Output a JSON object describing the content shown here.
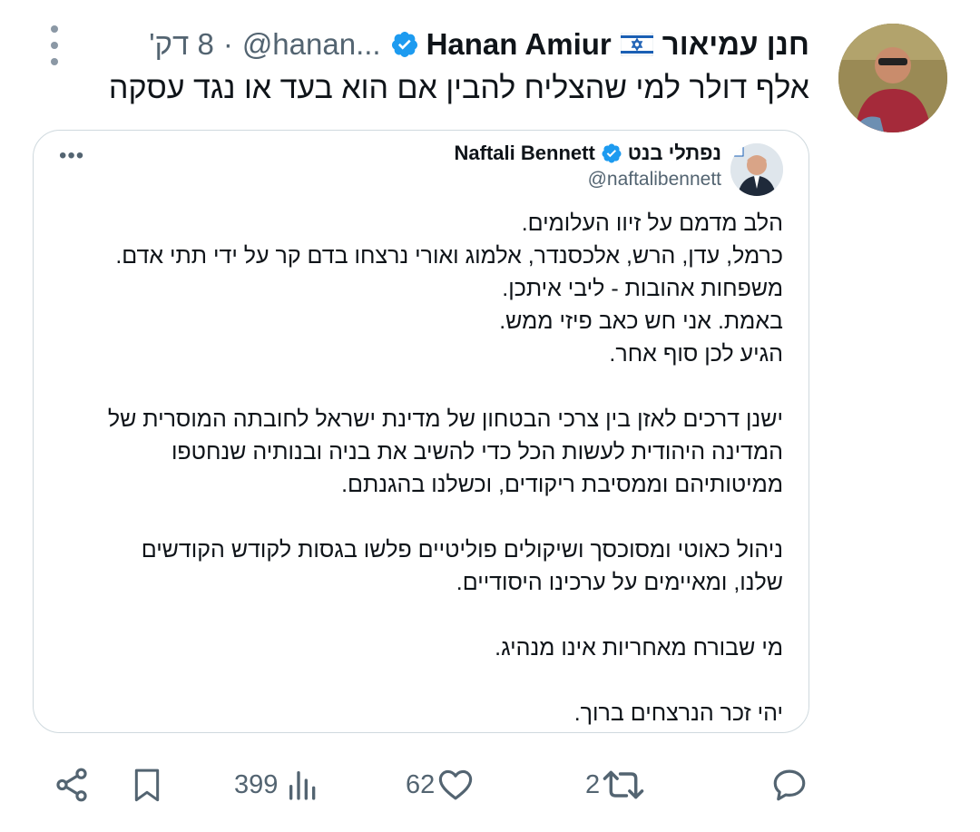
{
  "author": {
    "name": "חנן עמיאור",
    "flag_icon": "israel-flag-icon",
    "english_name": "Hanan Amiur",
    "verified_icon": "verified-badge-icon",
    "handle": "@hanan...",
    "separator": "·",
    "time": "8 דק'"
  },
  "tweet": {
    "text": "אלף דולר למי שהצליח להבין אם הוא בעד או נגד עסקה"
  },
  "quote": {
    "name_he": "נפתלי בנט",
    "name_en": "Naftali Bennett",
    "handle": "@naftalibennett",
    "more_label": "•••",
    "lines": [
      "הלב מדמם על זיוו העלומים.",
      "כרמל, עדן, הרש, אלכסנדר, אלמוג ואורי נרצחו בדם קר על ידי תתי אדם.",
      "משפחות אהובות - ליבי איתכן.",
      "באמת. אני חש כאב פיזי ממש.",
      "הגיע לכן סוף אחר.",
      "",
      "ישנן דרכים לאזן בין צרכי הבטחון של מדינת ישראל לחובתה המוסרית של",
      "המדינה היהודית לעשות הכל כדי להשיב את בניה ובנותיה שנחטפו",
      "ממיטותיהם וממסיבת ריקודים, וכשלנו בהגנתם.",
      "",
      "ניהול כאוטי ומסוכסך ושיקולים פוליטיים פלשו בגסות לקודש הקודשים",
      "שלנו, ומאיימים על ערכינו היסודיים.",
      "",
      "מי שבורח מאחריות אינו מנהיג.",
      "",
      "יהי זכר הנרצחים ברוך."
    ]
  },
  "actions": {
    "views": "399",
    "likes": "62",
    "retweets": "2"
  },
  "colors": {
    "verified": "#1d9bf0",
    "muted": "#536471",
    "text": "#0f1419",
    "border": "#cfd9de"
  }
}
